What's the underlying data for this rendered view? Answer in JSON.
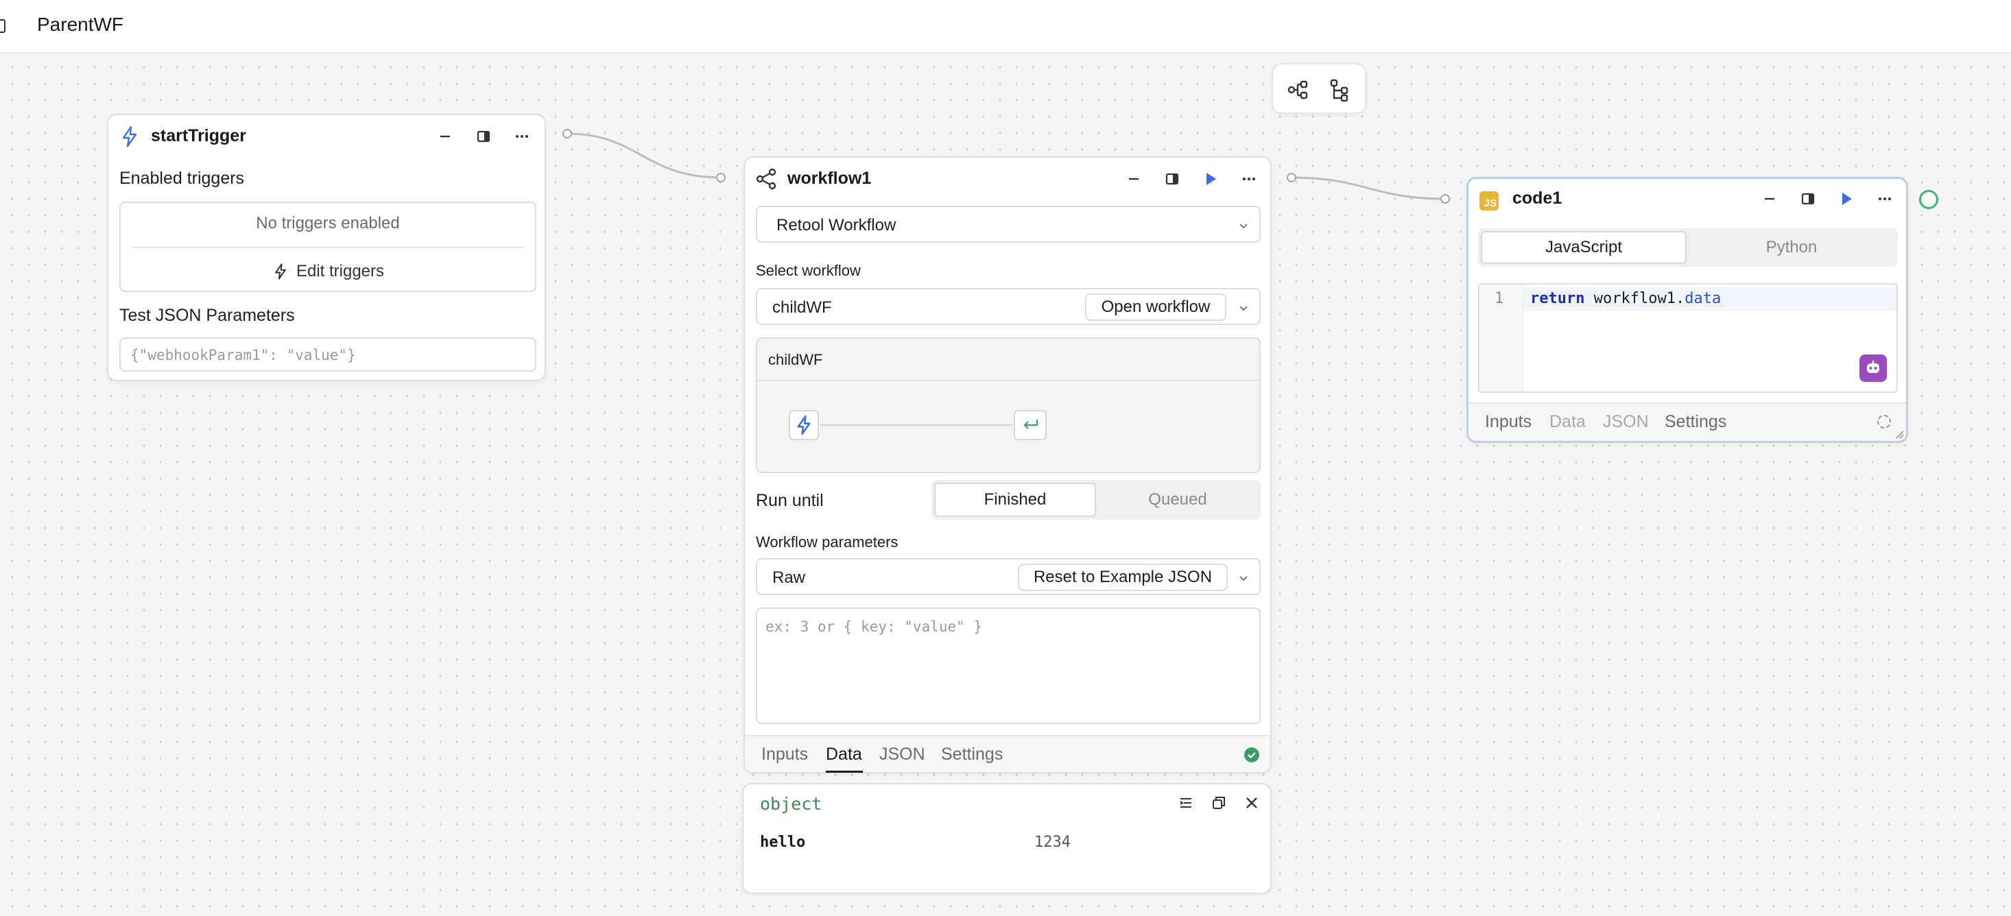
{
  "header": {
    "title": "ParentWF"
  },
  "startTrigger": {
    "title": "startTrigger",
    "enabled_label": "Enabled triggers",
    "no_triggers": "No triggers enabled",
    "edit_triggers": "Edit triggers",
    "test_label": "Test JSON Parameters",
    "test_placeholder": "{\"webhookParam1\": \"value\"}"
  },
  "workflow1": {
    "title": "workflow1",
    "resource_select": "Retool Workflow",
    "select_label": "Select workflow",
    "selected_workflow": "childWF",
    "open_button": "Open workflow",
    "preview_title": "childWF",
    "run_until_label": "Run until",
    "run_until_options": [
      "Finished",
      "Queued"
    ],
    "params_label": "Workflow parameters",
    "params_mode": "Raw",
    "reset_button": "Reset to Example JSON",
    "params_placeholder": "ex: 3 or { key: \"value\" }",
    "tabs": [
      "Inputs",
      "Data",
      "JSON",
      "Settings"
    ],
    "active_tab": "Data",
    "status_color": "#3c9d63"
  },
  "output": {
    "type_label": "object",
    "rows": [
      {
        "key": "hello",
        "value": "1234"
      }
    ]
  },
  "code1": {
    "title": "code1",
    "badge": "JS",
    "languages": [
      "JavaScript",
      "Python"
    ],
    "line_number": "1",
    "code_keyword": "return",
    "code_object": "workflow1",
    "code_dot": ".",
    "code_prop": "data",
    "tabs": [
      "Inputs",
      "Data",
      "JSON",
      "Settings"
    ]
  },
  "colors": {
    "accent": "#3d6fe0",
    "success": "#3fb36b",
    "assist": "#9b4dbf",
    "js_badge": "#e8b73a"
  }
}
